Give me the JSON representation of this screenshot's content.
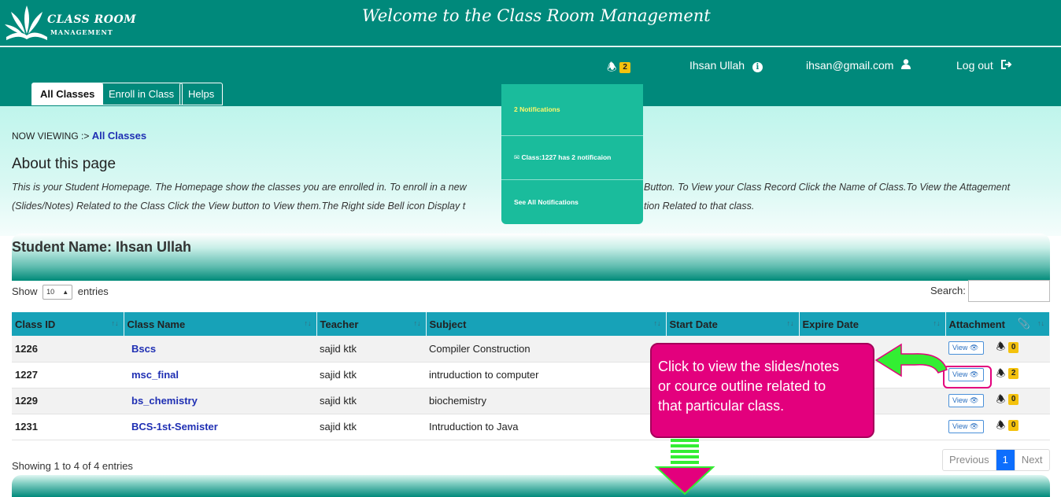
{
  "header": {
    "logo_line1": "CLASS ROOM",
    "logo_line2": "MANAGEMENT",
    "welcome": "Welcome to the Class Room Management"
  },
  "nav": {
    "bell_count": "2",
    "user_name": "Ihsan Ullah",
    "email": "ihsan@gmail.com",
    "logout": "Log out",
    "tabs": [
      {
        "label": "All Classes",
        "active": true
      },
      {
        "label": "Enroll in Class",
        "active": false
      },
      {
        "label": "Helps",
        "active": false
      }
    ]
  },
  "notifications": {
    "header": "2 Notifications",
    "item": "Class:1227  has  2 notificaion",
    "see_all": "See All Notifications"
  },
  "page": {
    "now_viewing_prefix": "NOW VIEWING :>",
    "now_viewing": "All Classes",
    "about_title": "About this page",
    "about_line1": "This is your Student Homepage. The Homepage show the classes you are enrolled in. To enroll in a new",
    "about_line1b": "Button. To View your Class Record Click the Name of Class.To View the Attagement",
    "about_line2": "(Slides/Notes) Related to the Class Click the View button to View them.The Right side Bell icon Display t",
    "about_line2b": "tion Related to that class.",
    "student_name": "Student Name: Ihsan Ullah"
  },
  "table_controls": {
    "show": "Show",
    "entries_value": "10",
    "entries": "entries",
    "search": "Search:",
    "showing": "Showing 1 to 4 of 4 entries",
    "pager": [
      "Previous",
      "1",
      "Next"
    ]
  },
  "table": {
    "columns": [
      "Class ID",
      "Class Name",
      "Teacher",
      "Subject",
      "Start Date",
      "Expire Date",
      "Attachment"
    ],
    "view_label": "View",
    "rows": [
      {
        "id": "1226",
        "name": "Bscs",
        "teacher": "sajid ktk",
        "subject": "Compiler Construction",
        "start": "",
        "expire": "",
        "notif": "0"
      },
      {
        "id": "1227",
        "name": "msc_final",
        "teacher": "sajid ktk",
        "subject": "intruduction to computer",
        "start": "",
        "expire": "",
        "notif": "2"
      },
      {
        "id": "1229",
        "name": "bs_chemistry",
        "teacher": "sajid ktk",
        "subject": "biochemistry",
        "start": "",
        "expire": "",
        "notif": "0"
      },
      {
        "id": "1231",
        "name": "BCS-1st-Semister",
        "teacher": "sajid ktk",
        "subject": "Intruduction to Java",
        "start": "",
        "expire": "",
        "notif": "0"
      }
    ]
  },
  "callout": {
    "line1": "Click to view the slides/notes",
    "line2": "or cource outline related to",
    "line3": "that particular  class."
  },
  "colors": {
    "teal": "#00897b",
    "table_header": "#17a2b8",
    "callout": "#e3007d",
    "arrow_green": "#33ee33",
    "badge": "#f4c20d"
  }
}
